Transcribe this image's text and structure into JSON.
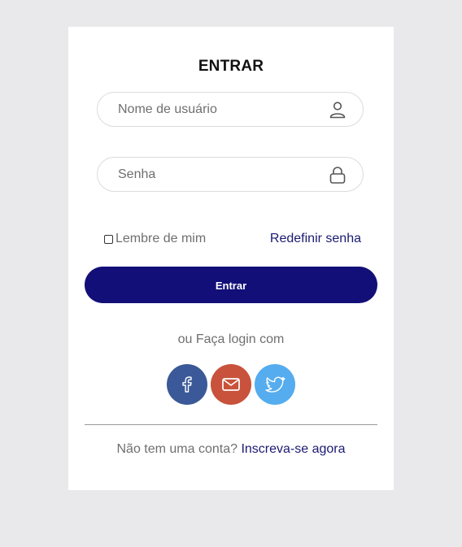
{
  "login": {
    "title": "ENTRAR",
    "username_placeholder": "Nome de usuário",
    "username_value": "",
    "password_placeholder": "Senha",
    "password_value": "",
    "remember_label": "Lembre de mim",
    "remember_checked": false,
    "reset_link": "Redefinir senha",
    "submit_label": "Entrar",
    "social_prompt": "ou Faça login com",
    "social_buttons": [
      {
        "icon": "facebook-icon",
        "color": "#3b5998"
      },
      {
        "icon": "mail-icon",
        "color": "#c8523b"
      },
      {
        "icon": "twitter-icon",
        "color": "#55acee"
      }
    ],
    "signup_prompt": "Não tem uma conta?",
    "signup_link": "Inscreva-se agora"
  },
  "colors": {
    "background": "#e9e9eb",
    "card": "#ffffff",
    "primary": "#120f78",
    "link": "#1a1a72"
  }
}
